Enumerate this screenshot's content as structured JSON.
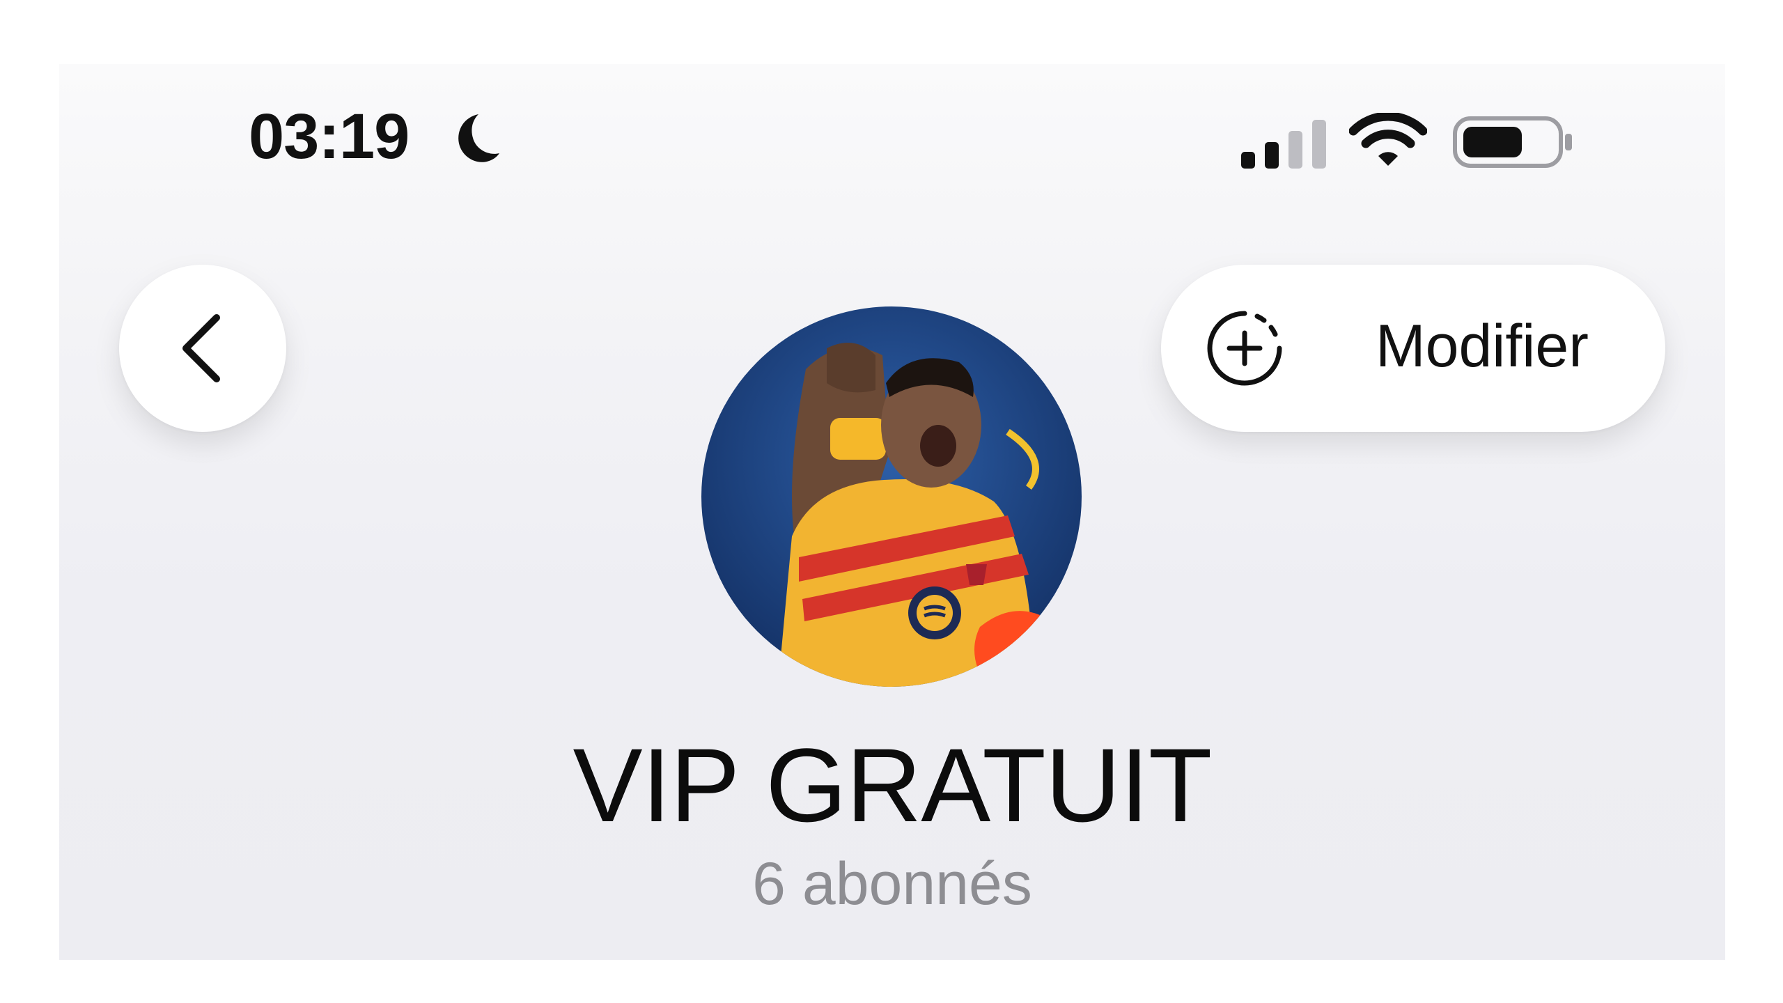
{
  "status_bar": {
    "time": "03:19",
    "focus_icon": "moon-icon",
    "signal_icon": "cellular-signal-icon",
    "wifi_icon": "wifi-icon",
    "battery_icon": "battery-icon"
  },
  "nav": {
    "back_icon": "chevron-left-icon",
    "modify_icon": "add-circle-icon",
    "modify_label": "Modifier"
  },
  "channel": {
    "avatar_icon": "channel-avatar",
    "title": "VIP GRATUIT",
    "subscribers": "6 abonnés"
  },
  "colors": {
    "background": "#efeff4",
    "button_bg": "#ffffff",
    "text_primary": "#111111",
    "text_secondary": "#8d8d92"
  }
}
